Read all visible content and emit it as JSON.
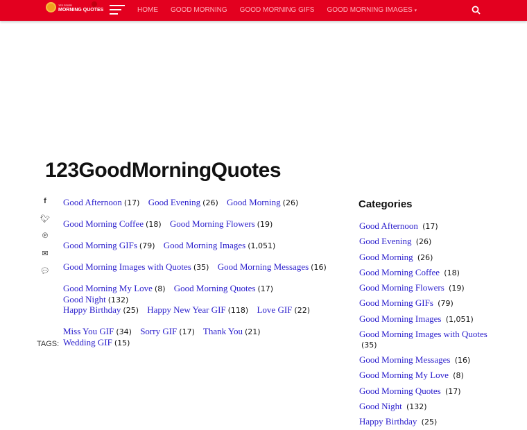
{
  "nav": {
    "logo_small": "123 GOOD",
    "logo": "MORNING QUOTES",
    "items": [
      "HOME",
      "GOOD MORNING",
      "GOOD MORNING GIFS",
      "GOOD MORNING IMAGES"
    ]
  },
  "title": "123GoodMorningQuotes",
  "share_icons": [
    "facebook-icon",
    "twitter-icon",
    "pinterest-icon",
    "email-icon",
    "comment-icon"
  ],
  "category_rows": [
    [
      {
        "n": "Good Afternoon",
        "c": "(17)"
      },
      {
        "n": "Good Evening",
        "c": "(26)"
      },
      {
        "n": "Good Morning",
        "c": "(26)"
      }
    ],
    [
      {
        "n": "Good Morning Coffee",
        "c": "(18)"
      },
      {
        "n": "Good Morning Flowers",
        "c": "(19)"
      }
    ],
    [
      {
        "n": "Good Morning GIFs",
        "c": "(79)"
      },
      {
        "n": "Good Morning Images",
        "c": "(1,051)"
      }
    ],
    [
      {
        "n": "Good Morning Images with Quotes",
        "c": "(35)"
      },
      {
        "n": "Good Morning Messages",
        "c": "(16)"
      }
    ],
    [
      {
        "n": "Good Morning My Love",
        "c": "(8)"
      },
      {
        "n": "Good Morning Quotes",
        "c": "(17)"
      },
      {
        "n": "Good Night",
        "c": "(132)"
      }
    ],
    [
      {
        "n": "Happy Birthday",
        "c": "(25)"
      },
      {
        "n": "Happy New Year GIF",
        "c": "(118)"
      },
      {
        "n": "Love GIF",
        "c": "(22)"
      }
    ],
    [
      {
        "n": "Miss You GIF",
        "c": "(34)"
      },
      {
        "n": "Sorry GIF",
        "c": "(17)"
      },
      {
        "n": "Thank You",
        "c": "(21)"
      },
      {
        "n": "Wedding GIF",
        "c": "(15)"
      }
    ]
  ],
  "tags_label": "TAGS:",
  "sidebar": {
    "title": "Categories",
    "items": [
      {
        "n": "Good Afternoon",
        "c": "(17)"
      },
      {
        "n": "Good Evening",
        "c": "(26)"
      },
      {
        "n": "Good Morning",
        "c": "(26)"
      },
      {
        "n": "Good Morning Coffee",
        "c": "(18)"
      },
      {
        "n": "Good Morning Flowers",
        "c": "(19)"
      },
      {
        "n": "Good Morning GIFs",
        "c": "(79)"
      },
      {
        "n": "Good Morning Images",
        "c": "(1,051)"
      },
      {
        "n": "Good Morning Images with Quotes",
        "c": "(35)"
      },
      {
        "n": "Good Morning Messages",
        "c": "(16)"
      },
      {
        "n": "Good Morning My Love",
        "c": "(8)"
      },
      {
        "n": "Good Morning Quotes",
        "c": "(17)"
      },
      {
        "n": "Good Night",
        "c": "(132)"
      },
      {
        "n": "Happy Birthday",
        "c": "(25)"
      }
    ]
  }
}
